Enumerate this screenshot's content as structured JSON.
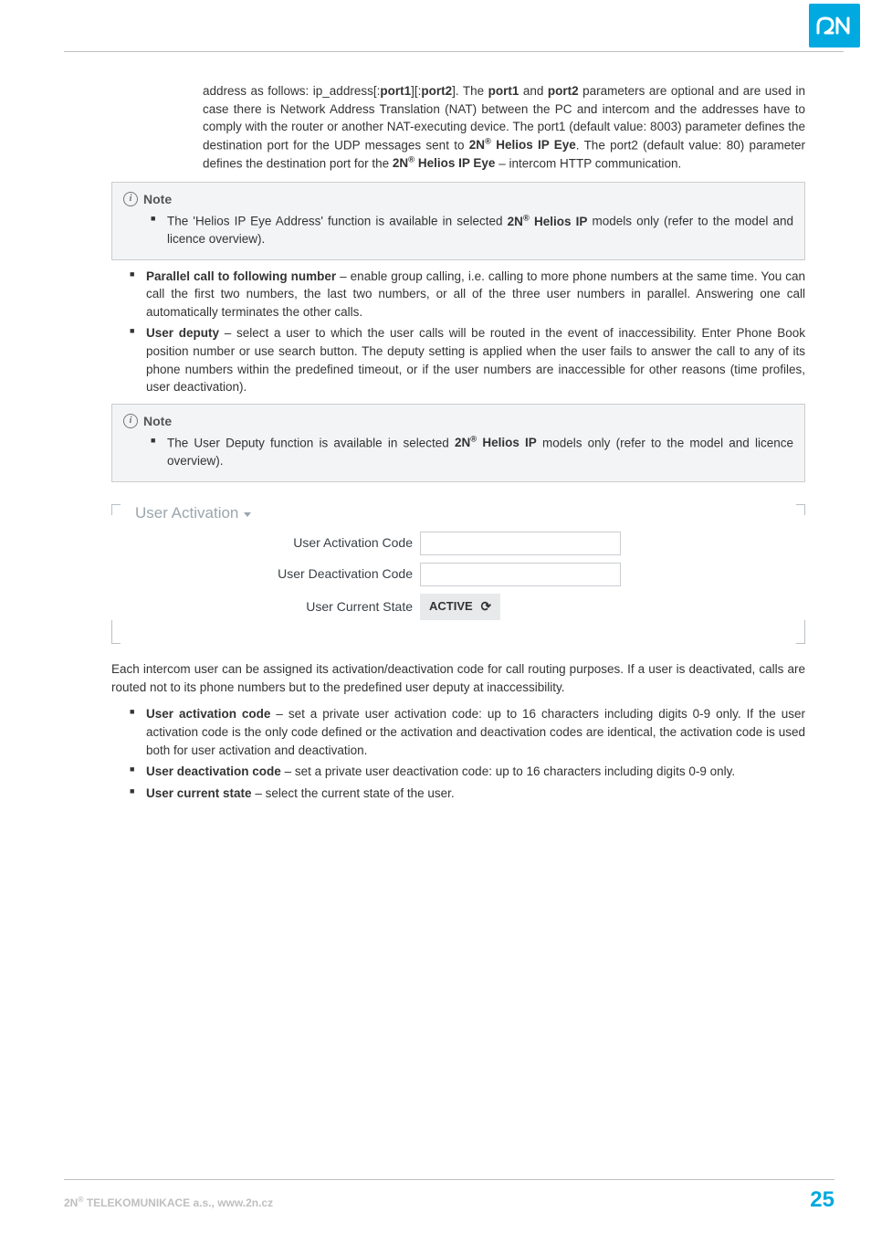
{
  "logo_alt": "2N",
  "intro_para": {
    "pre": "address as follows: ip_address[:",
    "port1": "port1",
    "mid1": "][:",
    "port2": "port2",
    "mid2": "]. The ",
    "port1b": "port1",
    "and": " and ",
    "port2b": "port2",
    "rest1": " parameters are optional and are used in case there is Network Address Translation (NAT) between the PC and intercom and the addresses have to comply with the router or another NAT-executing device. The port1 (default value: 8003) parameter defines the destination port for the UDP messages sent to ",
    "brand1": "2N",
    "sup": "®",
    "brand1b": " Helios IP Eye",
    "rest2": ". The port2 (default value: 80) parameter defines the destination port for the ",
    "brand2": "2N",
    "brand2b": " Helios IP Eye",
    "rest3": " – intercom HTTP communication."
  },
  "note_label": "Note",
  "note1": {
    "pre": "The 'Helios IP Eye Address' function is available in selected ",
    "brand": "2N",
    "sup": "®",
    "brandb": " Helios IP",
    "post": " models only (refer to the model and licence overview)."
  },
  "bullets1": [
    {
      "term": "Parallel call to following number",
      "rest": " – enable group calling, i.e. calling to more phone numbers at the same time. You can call the first two numbers, the last two numbers, or all of the three user numbers in parallel. Answering one call automatically terminates the other calls."
    },
    {
      "term": "User deputy",
      "rest": " – select a user to which the user calls will be routed in the event of inaccessibility. Enter Phone Book position number or use search button. The deputy setting is applied when the user fails to answer the call to any of its phone numbers within the predefined timeout, or if the user numbers are inaccessible for other reasons (time profiles, user deactivation)."
    }
  ],
  "note2": {
    "pre": "The User Deputy function is available in selected ",
    "brand": "2N",
    "sup": "®",
    "brandb": " Helios IP",
    "post": " models only (refer to the model and licence overview)."
  },
  "fieldset": {
    "legend": "User Activation",
    "activation_label": "User Activation Code",
    "deactivation_label": "User Deactivation Code",
    "state_label": "User Current State",
    "state_value": "ACTIVE"
  },
  "desc_para": "Each intercom user can be assigned its activation/deactivation code for call routing purposes. If a user is deactivated, calls are routed not to its phone numbers but to the predefined user deputy at inaccessibility.",
  "bullets2": [
    {
      "term": "User activation code",
      "rest": " – set a private user activation code: up to 16 characters including digits 0-9 only. If the user activation code is the only code defined or the activation and deactivation codes are identical, the activation code is used both for user activation and deactivation."
    },
    {
      "term": "User deactivation code",
      "rest": " – set a private user deactivation code: up to 16 characters including digits 0-9 only."
    },
    {
      "term": "User current state",
      "rest": " – select the current state of the user."
    }
  ],
  "footer": {
    "company_pre": "2N",
    "company_sup": "®",
    "company_post": " TELEKOMUNIKACE a.s., www.2n.cz",
    "page": "25"
  }
}
